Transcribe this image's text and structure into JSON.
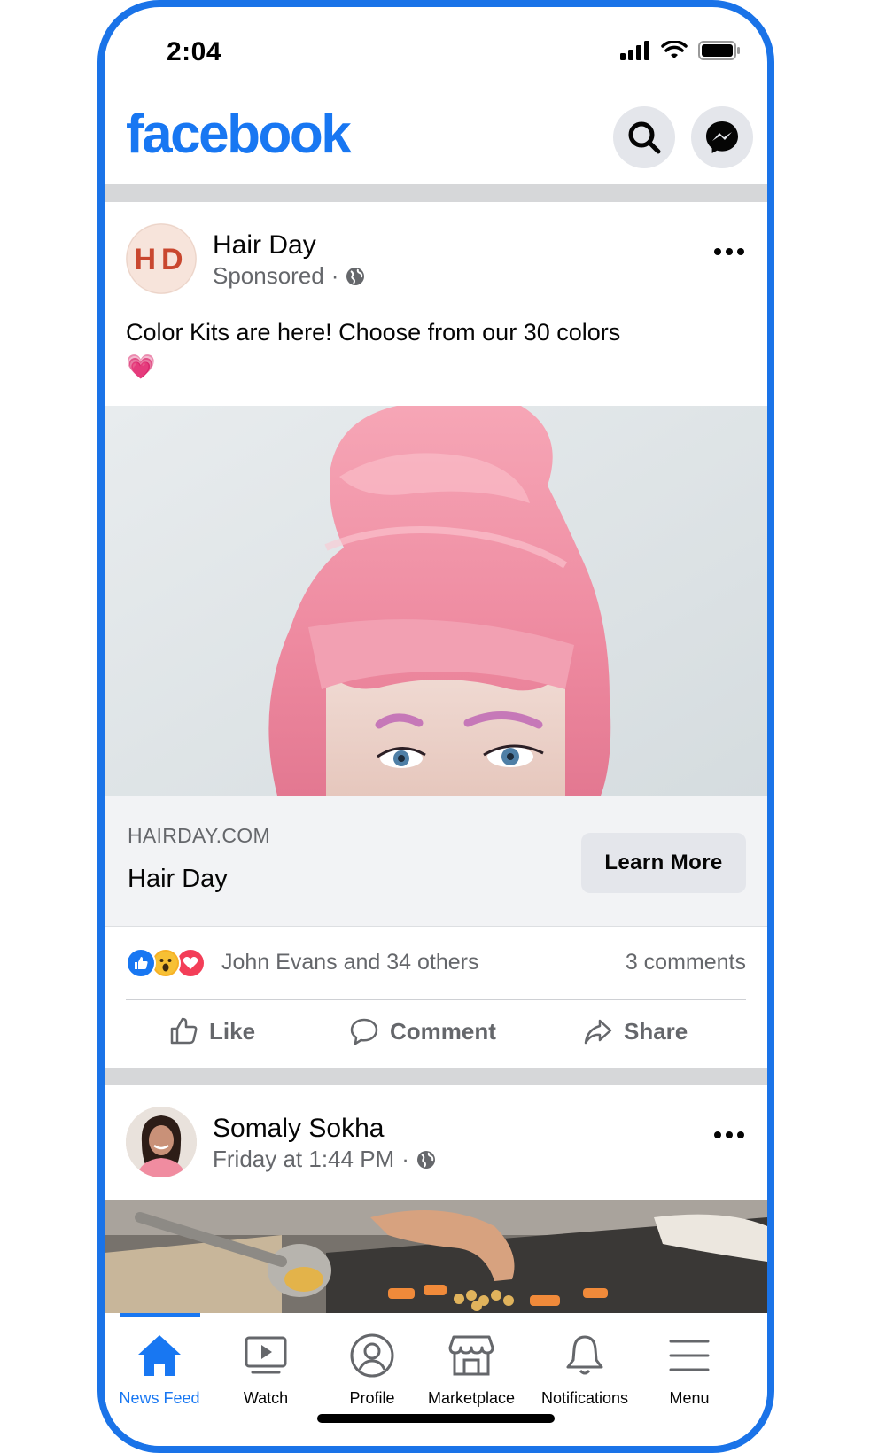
{
  "status_bar": {
    "time": "2:04",
    "icons": [
      "signal-icon",
      "wifi-icon",
      "battery-icon"
    ]
  },
  "header": {
    "logo": "facebook",
    "actions": [
      "search-icon",
      "messenger-icon"
    ],
    "brand_color": "#1877f2"
  },
  "post1": {
    "avatar_text": "HD",
    "author": "Hair Day",
    "meta": "Sponsored",
    "privacy_icon": "globe-icon",
    "text": "Color Kits are here! Choose from our 30 colors 💗",
    "link": {
      "domain": "HAIRDAY.COM",
      "title": "Hair Day",
      "cta": "Learn More"
    },
    "reactions": {
      "icons": [
        "like-reaction-icon",
        "wow-reaction-icon",
        "love-reaction-icon"
      ],
      "text": "John Evans and 34 others",
      "comments": "3 comments"
    },
    "actions": {
      "like": "Like",
      "comment": "Comment",
      "share": "Share"
    }
  },
  "post2": {
    "author": "Somaly Sokha",
    "meta": "Friday at 1:44 PM",
    "privacy_icon": "globe-icon"
  },
  "tabbar": {
    "tabs": [
      {
        "label": "News Feed",
        "icon": "home-icon",
        "active": true
      },
      {
        "label": "Watch",
        "icon": "watch-icon",
        "active": false
      },
      {
        "label": "Profile",
        "icon": "profile-icon",
        "active": false
      },
      {
        "label": "Marketplace",
        "icon": "marketplace-icon",
        "active": false
      },
      {
        "label": "Notifications",
        "icon": "bell-icon",
        "active": false
      },
      {
        "label": "Menu",
        "icon": "menu-icon",
        "active": false
      }
    ]
  }
}
